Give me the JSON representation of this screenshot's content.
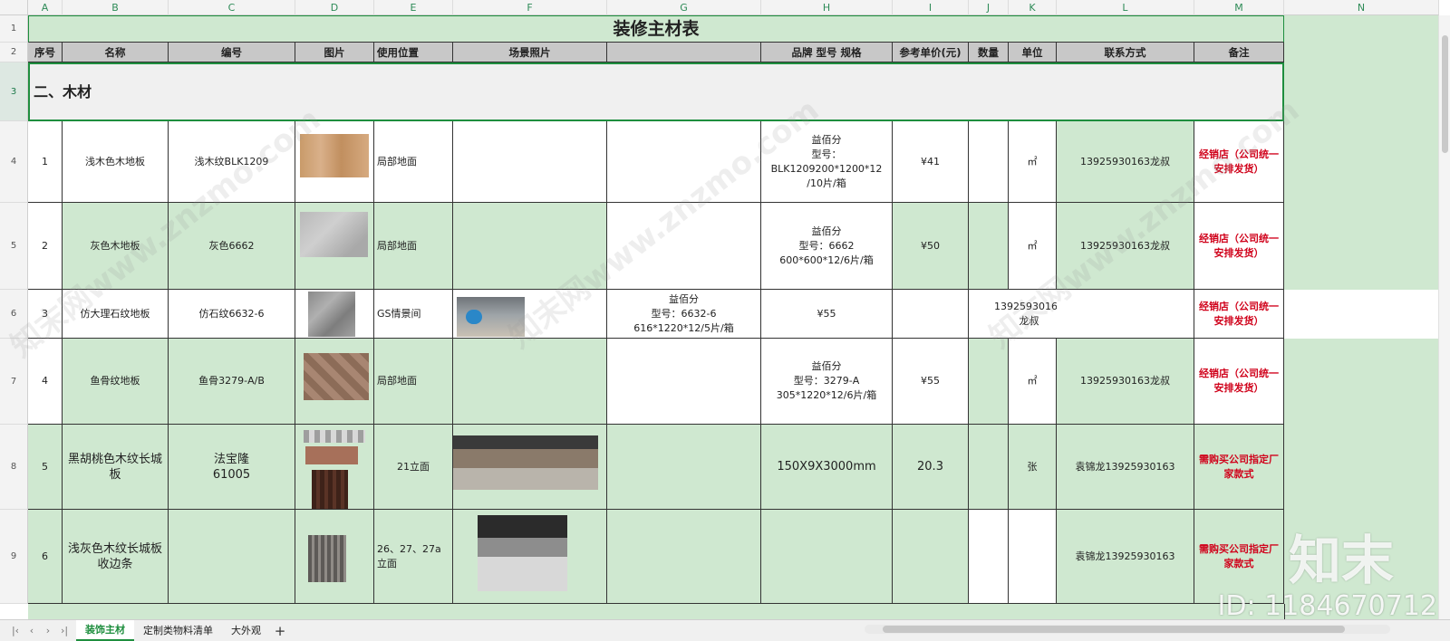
{
  "columns": [
    "A",
    "B",
    "C",
    "D",
    "E",
    "F",
    "G",
    "H",
    "I",
    "J",
    "K",
    "L",
    "M",
    "N"
  ],
  "rows": [
    "1",
    "2",
    "3",
    "4",
    "5",
    "6",
    "7",
    "8",
    "9"
  ],
  "title": "装修主材表",
  "headers": {
    "seq": "序号",
    "name": "名称",
    "code": "编号",
    "image": "图片",
    "position": "使用位置",
    "scene": "场景照片",
    "brand": "品牌 型号 规格",
    "price": "参考单价(元)",
    "qty": "数量",
    "unit": "单位",
    "contact": "联系方式",
    "note": "备注"
  },
  "section": "二、木材",
  "items": [
    {
      "seq": "1",
      "name": "浅木色木地板",
      "code": "浅木纹BLK1209",
      "position": "局部地面",
      "brand": "益佰分\n型号：BLK1209200*1200*12\n/10片/箱",
      "price": "¥41",
      "unit": "㎡",
      "contact": "13925930163龙叔",
      "note": "经销店（公司统一安排发货）"
    },
    {
      "seq": "2",
      "name": "灰色木地板",
      "code": "灰色6662",
      "position": "局部地面",
      "brand": "益佰分\n型号：6662\n600*600*12/6片/箱",
      "price": "¥50",
      "unit": "㎡",
      "contact": "13925930163龙叔",
      "note": "经销店（公司统一安排发货）"
    },
    {
      "seq": "3",
      "name": "仿大理石纹地板",
      "code": "仿石纹6632-6",
      "position": "GS情景间",
      "brand": "益佰分\n型号：6632-6\n616*1220*12/5片/箱",
      "price": "¥55",
      "unit": "",
      "contact": "13925930163龙叔",
      "note": "经销店（公司统一安排发货）"
    },
    {
      "seq": "4",
      "name": "鱼骨纹地板",
      "code": "鱼骨3279-A/B",
      "position": "局部地面",
      "brand": "益佰分\n型号：3279-A\n305*1220*12/6片/箱",
      "price": "¥55",
      "unit": "㎡",
      "contact": "13925930163龙叔",
      "note": "经销店（公司统一安排发货）"
    },
    {
      "seq": "5",
      "name": "黑胡桃色木纹长城板",
      "code": "法宝隆\n61005",
      "position": "21立面",
      "brand": "150X9X3000mm",
      "price": "20.3",
      "unit": "张",
      "contact": "袁锦龙13925930163",
      "note": "需购买公司指定厂家款式"
    },
    {
      "seq": "6",
      "name": "浅灰色木纹长城板收边条",
      "code": "",
      "position": "26、27、27a立面",
      "brand": "",
      "price": "",
      "unit": "",
      "contact": "袁锦龙13925930163",
      "note": "需购买公司指定厂家款式"
    }
  ],
  "tabs": [
    "装饰主材",
    "定制类物料清单",
    "大外观"
  ],
  "add_tab": "+",
  "nav": [
    "|‹",
    "‹",
    "›",
    "›|"
  ],
  "watermark": "知末网www.znzmo.com",
  "logo_watermark": "知末",
  "id_watermark": "ID: 1184670712",
  "colors": {
    "green": "#cfe8d0",
    "header": "#c8c8c8",
    "red": "#d0021b",
    "tab_active": "#1e8e3e"
  }
}
